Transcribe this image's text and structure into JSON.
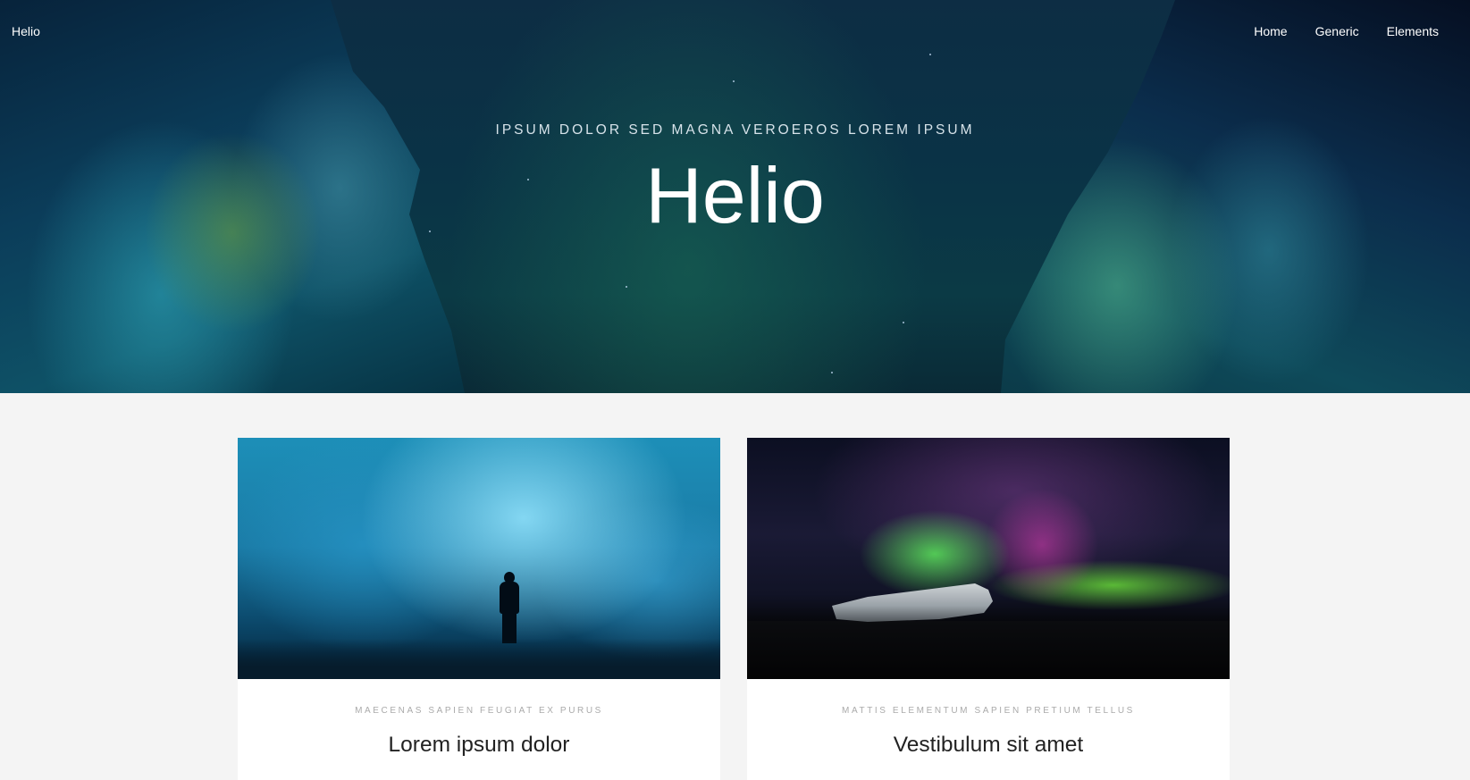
{
  "nav": {
    "logo": "Helio",
    "links": [
      "Home",
      "Generic",
      "Elements"
    ]
  },
  "hero": {
    "subtitle": "IPSUM DOLOR SED MAGNA VEROEROS LOREM IPSUM",
    "title": "Helio"
  },
  "cards": [
    {
      "tags": "MAECENAS  SAPIEN  FEUGIAT  EX  PURUS",
      "title": "Lorem ipsum dolor",
      "image": "ice-cave-photo"
    },
    {
      "tags": "MATTIS  ELEMENTUM  SAPIEN  PRETIUM  TELLUS",
      "title": "Vestibulum sit amet",
      "image": "aurora-plane-photo"
    }
  ],
  "colors": {
    "page_background": "#f4f4f4",
    "hero_text": "#ffffff",
    "tag_text": "#aaaaaa",
    "card_title": "#222222"
  }
}
